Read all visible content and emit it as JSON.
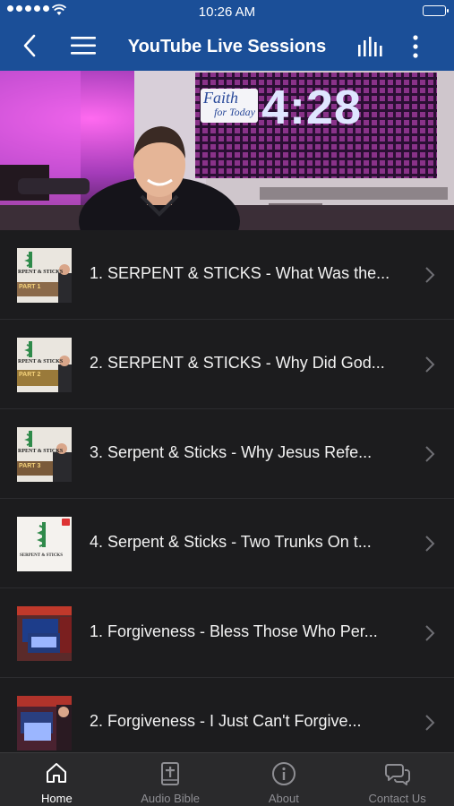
{
  "status_bar": {
    "time": "10:26 AM"
  },
  "nav": {
    "title": "YouTube Live Sessions"
  },
  "hero": {
    "logo_line1": "Faith",
    "logo_line2": "for Today",
    "counter": "4:28"
  },
  "list": {
    "items": [
      {
        "title": "1. SERPENT & STICKS - What Was the...",
        "thumb_line1": "RPENT & STICKS",
        "thumb_part": "PART 1",
        "thumb_style": "serpent"
      },
      {
        "title": "2. SERPENT & STICKS - Why Did God...",
        "thumb_line1": "RPENT & STICKS",
        "thumb_part": "PART 2",
        "thumb_style": "serpent"
      },
      {
        "title": "3. Serpent & Sticks - Why Jesus Refe...",
        "thumb_line1": "RPENT & STICKS",
        "thumb_part": "PART 3",
        "thumb_style": "serpent"
      },
      {
        "title": "4. Serpent & Sticks - Two Trunks On t...",
        "thumb_line1": "SERPENT & STICKS",
        "thumb_part": "",
        "thumb_style": "serpent-plain"
      },
      {
        "title": "1. Forgiveness - Bless Those Who Per...",
        "thumb_line1": "",
        "thumb_part": "",
        "thumb_style": "studio"
      },
      {
        "title": "2. Forgiveness - I Just Can't Forgive...",
        "thumb_line1": "",
        "thumb_part": "",
        "thumb_style": "studio"
      }
    ]
  },
  "tabbar": {
    "tabs": [
      {
        "label": "Home",
        "active": true
      },
      {
        "label": "Audio Bible",
        "active": false
      },
      {
        "label": "About",
        "active": false
      },
      {
        "label": "Contact Us",
        "active": false
      }
    ]
  },
  "colors": {
    "nav_bg": "#1b4f98",
    "list_bg": "#1c1c1e",
    "tab_bg": "#2a2a2c",
    "tab_active": "#ffffff",
    "tab_inactive": "#8e8e93"
  }
}
